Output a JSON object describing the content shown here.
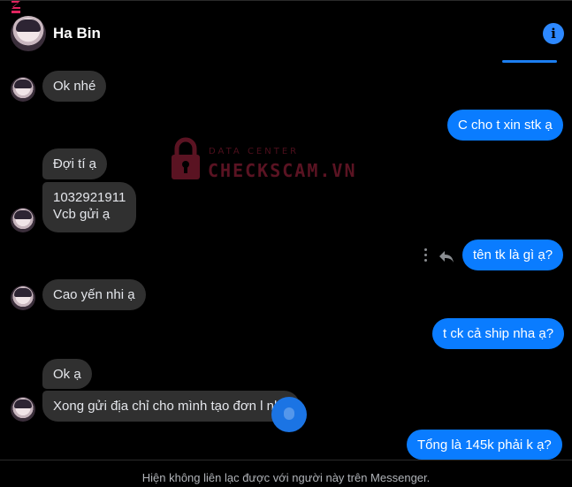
{
  "contact": {
    "name": "Ha Bin"
  },
  "watermark": {
    "line1": "DATA CENTER",
    "line2": "CHECKSCAM.VN"
  },
  "messages": [
    {
      "text": "Ok nhé"
    },
    {
      "text": "C cho t xin stk ạ"
    },
    {
      "text": "Đợi tí ạ"
    },
    {
      "text": "1032921911"
    },
    {
      "text": "Vcb gửi ạ"
    },
    {
      "text": "tên tk là gì ạ?"
    },
    {
      "text": "Cao yến nhi ạ"
    },
    {
      "text": "t ck cả ship nha ạ?"
    },
    {
      "text": "Ok ạ"
    },
    {
      "text": "Xong gửi địa chỉ cho mình tạo đơn l nhé"
    },
    {
      "text": "Tổng là 145k phải k ạ?"
    }
  ],
  "footer": {
    "notice": "Hiện không liên lạc được với người này trên Messenger."
  },
  "colors": {
    "outgoing": "#0a7cff",
    "incoming": "#303030",
    "background": "#000000"
  },
  "icons": [
    "info-icon",
    "more-dots-icon",
    "reply-icon",
    "scroll-down-icon"
  ]
}
